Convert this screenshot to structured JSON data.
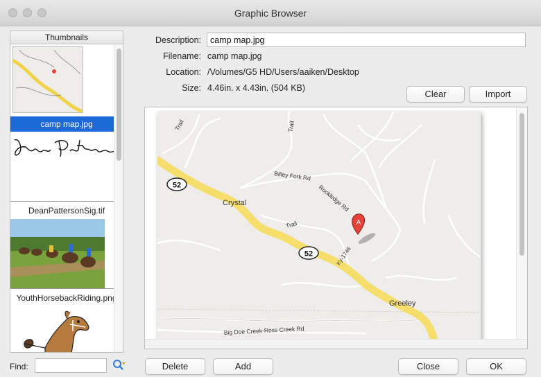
{
  "window": {
    "title": "Graphic Browser"
  },
  "thumbnails": {
    "header": "Thumbnails",
    "items": [
      {
        "label": "camp map.jpg",
        "selected": true
      },
      {
        "label": "DeanPattersonSig.tif",
        "selected": false
      },
      {
        "label": "YouthHorsebackRiding.png",
        "selected": false
      },
      {
        "label": "",
        "selected": false
      }
    ]
  },
  "find": {
    "label": "Find:",
    "value": ""
  },
  "details": {
    "description_label": "Description:",
    "description_value": "camp map.jpg",
    "filename_label": "Filename:",
    "filename_value": "camp map.jpg",
    "location_label": "Location:",
    "location_value": "/Volumes/G5 HD/Users/aaiken/Desktop",
    "size_label": "Size:",
    "size_value": "4.46in. x 4.43in. (504 KB)"
  },
  "buttons": {
    "clear": "Clear",
    "import": "Import",
    "delete": "Delete",
    "add": "Add",
    "close": "Close",
    "ok": "OK"
  },
  "map": {
    "labels": {
      "route_a": "52",
      "route_b": "52",
      "crystal": "Crystal",
      "greeley": "Greeley",
      "billey_fork": "Billey Fork Rd",
      "rockledge": "Rockledge Rd",
      "trail_a": "Trail",
      "trail_b": "Trail",
      "trail_c": "Trail",
      "kyroad": "Ky-1746",
      "bigdoe": "Big Doe Creek-Ross Creek Rd",
      "marker": "A"
    },
    "colors": {
      "background": "#efedea",
      "highway": "#f5de6b",
      "road": "#ffffff",
      "marker": "#e8433a"
    }
  }
}
